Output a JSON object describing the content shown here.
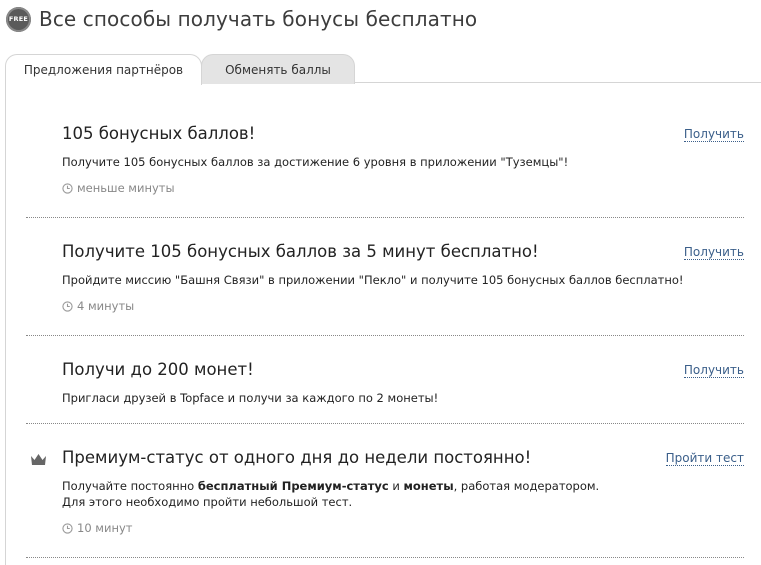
{
  "header": {
    "badge_text": "FREE",
    "title": "Все способы получать бонусы бесплатно"
  },
  "tabs": [
    {
      "label": "Предложения партнёров",
      "active": true
    },
    {
      "label": "Обменять баллы",
      "active": false
    }
  ],
  "offers": [
    {
      "title": "105 бонусных баллов!",
      "description": "Получите 105 бонусных баллов за достижение 6 уровня в приложении \"Туземцы\"!",
      "time": "меньше минуты",
      "action": "Получить"
    },
    {
      "title": "Получите 105 бонусных баллов за 5 минут бесплатно!",
      "description": "Пройдите миссию \"Башня Связи\" в приложении \"Пекло\" и получите 105 бонусных баллов бесплатно!",
      "time": "4 минуты",
      "action": "Получить"
    },
    {
      "title": "Получи до 200 монет!",
      "description": "Пригласи друзей в Topface и получи за каждого по 2 монеты!",
      "action": "Получить"
    },
    {
      "title": "Премиум-статус от одного дня до недели постоянно!",
      "description_parts": {
        "p1": "Получайте постоянно ",
        "b1": "бесплатный Премиум-статус",
        "p2": " и ",
        "b2": "монеты",
        "p3": ", работая модератором.",
        "line2": "Для этого необходимо пройти небольшой тест."
      },
      "time": "10 минут",
      "action": "Пройти тест",
      "icon": "crown-icon"
    }
  ],
  "colors": {
    "link": "#3b5f8a",
    "muted": "#888888",
    "tab_inactive_bg": "#e4e4e4"
  }
}
